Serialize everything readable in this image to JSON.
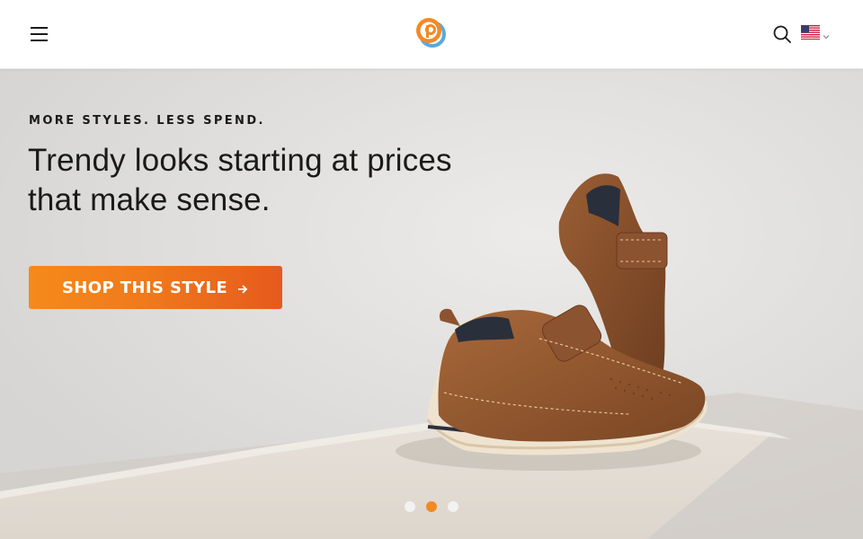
{
  "header": {
    "menu_icon": "hamburger-menu-icon",
    "logo_icon": "brand-logo-icon",
    "search_icon": "search-icon",
    "locale_flag": "us-flag-icon",
    "locale_chevron": "chevron-down-icon"
  },
  "hero": {
    "eyebrow": "MORE STYLES. LESS SPEND.",
    "headline_line1": "Trendy looks starting at prices",
    "headline_line2": "that make sense.",
    "cta_label": "SHOP THIS STYLE",
    "cta_icon": "arrow-right-icon",
    "image": "brown-kids-shoes-on-shelf",
    "slides": {
      "count": 3,
      "active_index": 2
    }
  },
  "colors": {
    "accent_orange": "#f28a24",
    "cta_gradient_start": "#f58a1a",
    "cta_gradient_end": "#e65a1c",
    "text_dark": "#1a1a1a"
  }
}
